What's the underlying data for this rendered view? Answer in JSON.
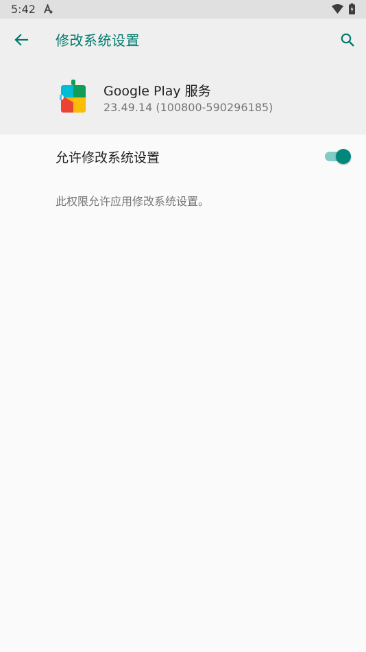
{
  "status_bar": {
    "time": "5:42",
    "app_icon": "accessibility-a-icon",
    "wifi_icon": "wifi-icon",
    "battery_icon": "battery-charging-icon"
  },
  "app_bar": {
    "back_icon": "arrow-left-icon",
    "title": "修改系统设置",
    "search_icon": "search-icon"
  },
  "app_info": {
    "name": "Google Play 服务",
    "version": "23.49.14 (100800-590296185)",
    "icon": "google-play-services-icon"
  },
  "setting": {
    "label": "允许修改系统设置",
    "enabled": true
  },
  "description": "此权限允许应用修改系统设置。",
  "colors": {
    "accent": "#00796b",
    "toggle_thumb": "#00897b",
    "toggle_track": "#80cbc4",
    "header_bg": "#efefef",
    "status_bg": "#e0e0e0"
  }
}
